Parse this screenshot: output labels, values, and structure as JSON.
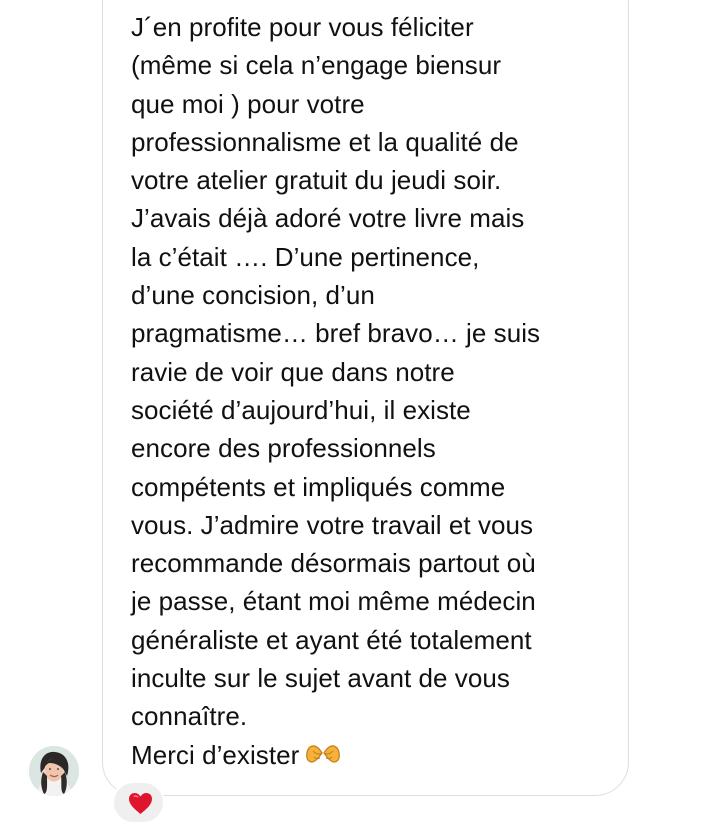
{
  "message": {
    "lines": [
      "J´en profite pour vous féliciter",
      "(même si cela n’engage biensur",
      "que moi ) pour votre",
      "professionnalisme et la qualité de",
      "votre atelier gratuit du jeudi soir.",
      "J’avais déjà adoré votre livre mais",
      "la c’était …. D’une pertinence,",
      "d’une concision, d’un",
      "pragmatisme… bref bravo… je suis",
      "ravie de voir que dans notre",
      "société d’aujourd’hui, il existe",
      "encore des professionnels",
      "compétents et impliqués comme",
      "vous. J’admire votre travail et vous",
      "recommande désormais partout où",
      "je passe, étant moi même médecin",
      "généraliste et ayant été totalement",
      "inculte sur le sujet avant de vous",
      "connaître.",
      "Merci d’exister"
    ],
    "closing_emoji_icon": "heart-hands-emoji-icon"
  },
  "sender": {
    "avatar_icon": "profile-avatar"
  },
  "reaction": {
    "icon": "red-heart-icon",
    "color": "#e0142d"
  },
  "colors": {
    "text": "#111111",
    "bubble_border": "#dedede",
    "reaction_background": "#efefef"
  }
}
